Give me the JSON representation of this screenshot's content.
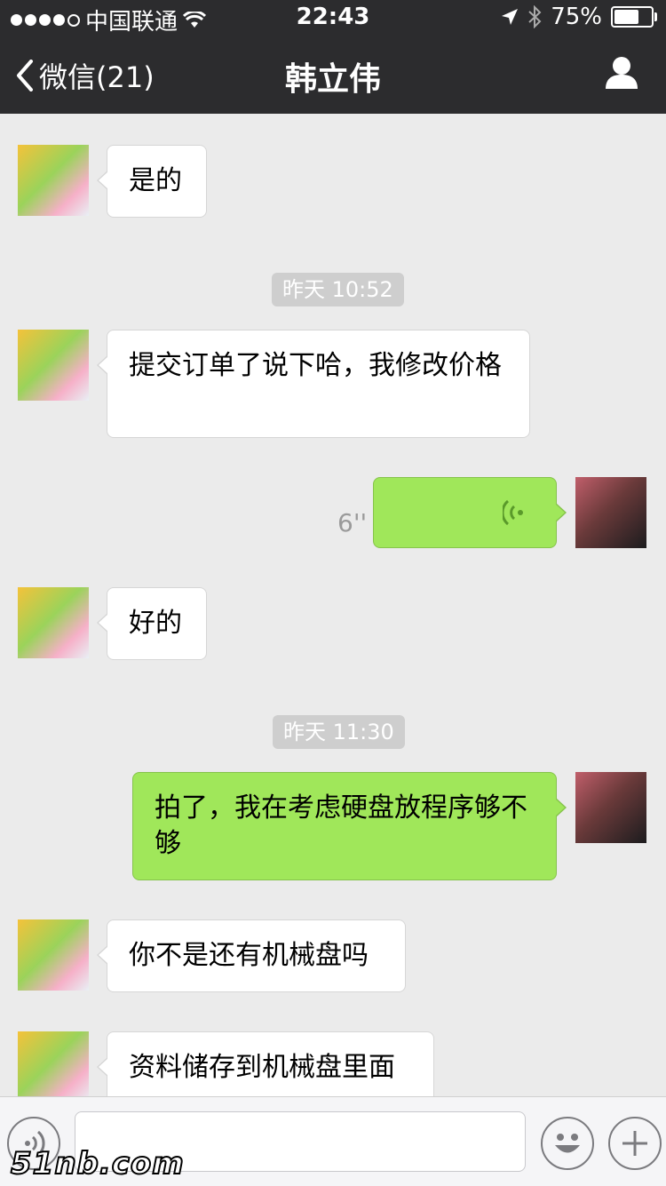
{
  "status_bar": {
    "carrier": "中国联通",
    "time": "22:43",
    "battery_percent": "75%",
    "battery_level": 0.75,
    "signal_dots_filled": 4,
    "signal_dots_total": 5
  },
  "nav": {
    "back_label": "微信(21)",
    "title": "韩立伟"
  },
  "messages": [
    {
      "type": "text",
      "from": "contact",
      "text": "是的"
    },
    {
      "type": "timestamp",
      "text": "昨天 10:52"
    },
    {
      "type": "text",
      "from": "contact",
      "text": "提交订单了说下哈，我修改价格"
    },
    {
      "type": "voice",
      "from": "me",
      "duration": "6''"
    },
    {
      "type": "text",
      "from": "contact",
      "text": "好的"
    },
    {
      "type": "timestamp",
      "text": "昨天 11:30"
    },
    {
      "type": "text",
      "from": "me",
      "text": "拍了，我在考虑硬盘放程序够不够"
    },
    {
      "type": "text",
      "from": "contact",
      "text": "你不是还有机械盘吗"
    },
    {
      "type": "text",
      "from": "contact",
      "text": "资料储存到机械盘里面"
    }
  ],
  "watermark": "51nb.com",
  "colors": {
    "nav_bg": "#2c2c2e",
    "chat_bg": "#ebebeb",
    "out_bubble": "#a0e75a",
    "in_bubble": "#ffffff",
    "timestamp_bg": "#cecece"
  },
  "icons": [
    "back-chevron-icon",
    "profile-icon",
    "voice-wave-icon",
    "voice-input-icon",
    "emoji-icon",
    "plus-icon",
    "wifi-icon",
    "location-arrow-icon",
    "bluetooth-icon",
    "battery-icon"
  ]
}
